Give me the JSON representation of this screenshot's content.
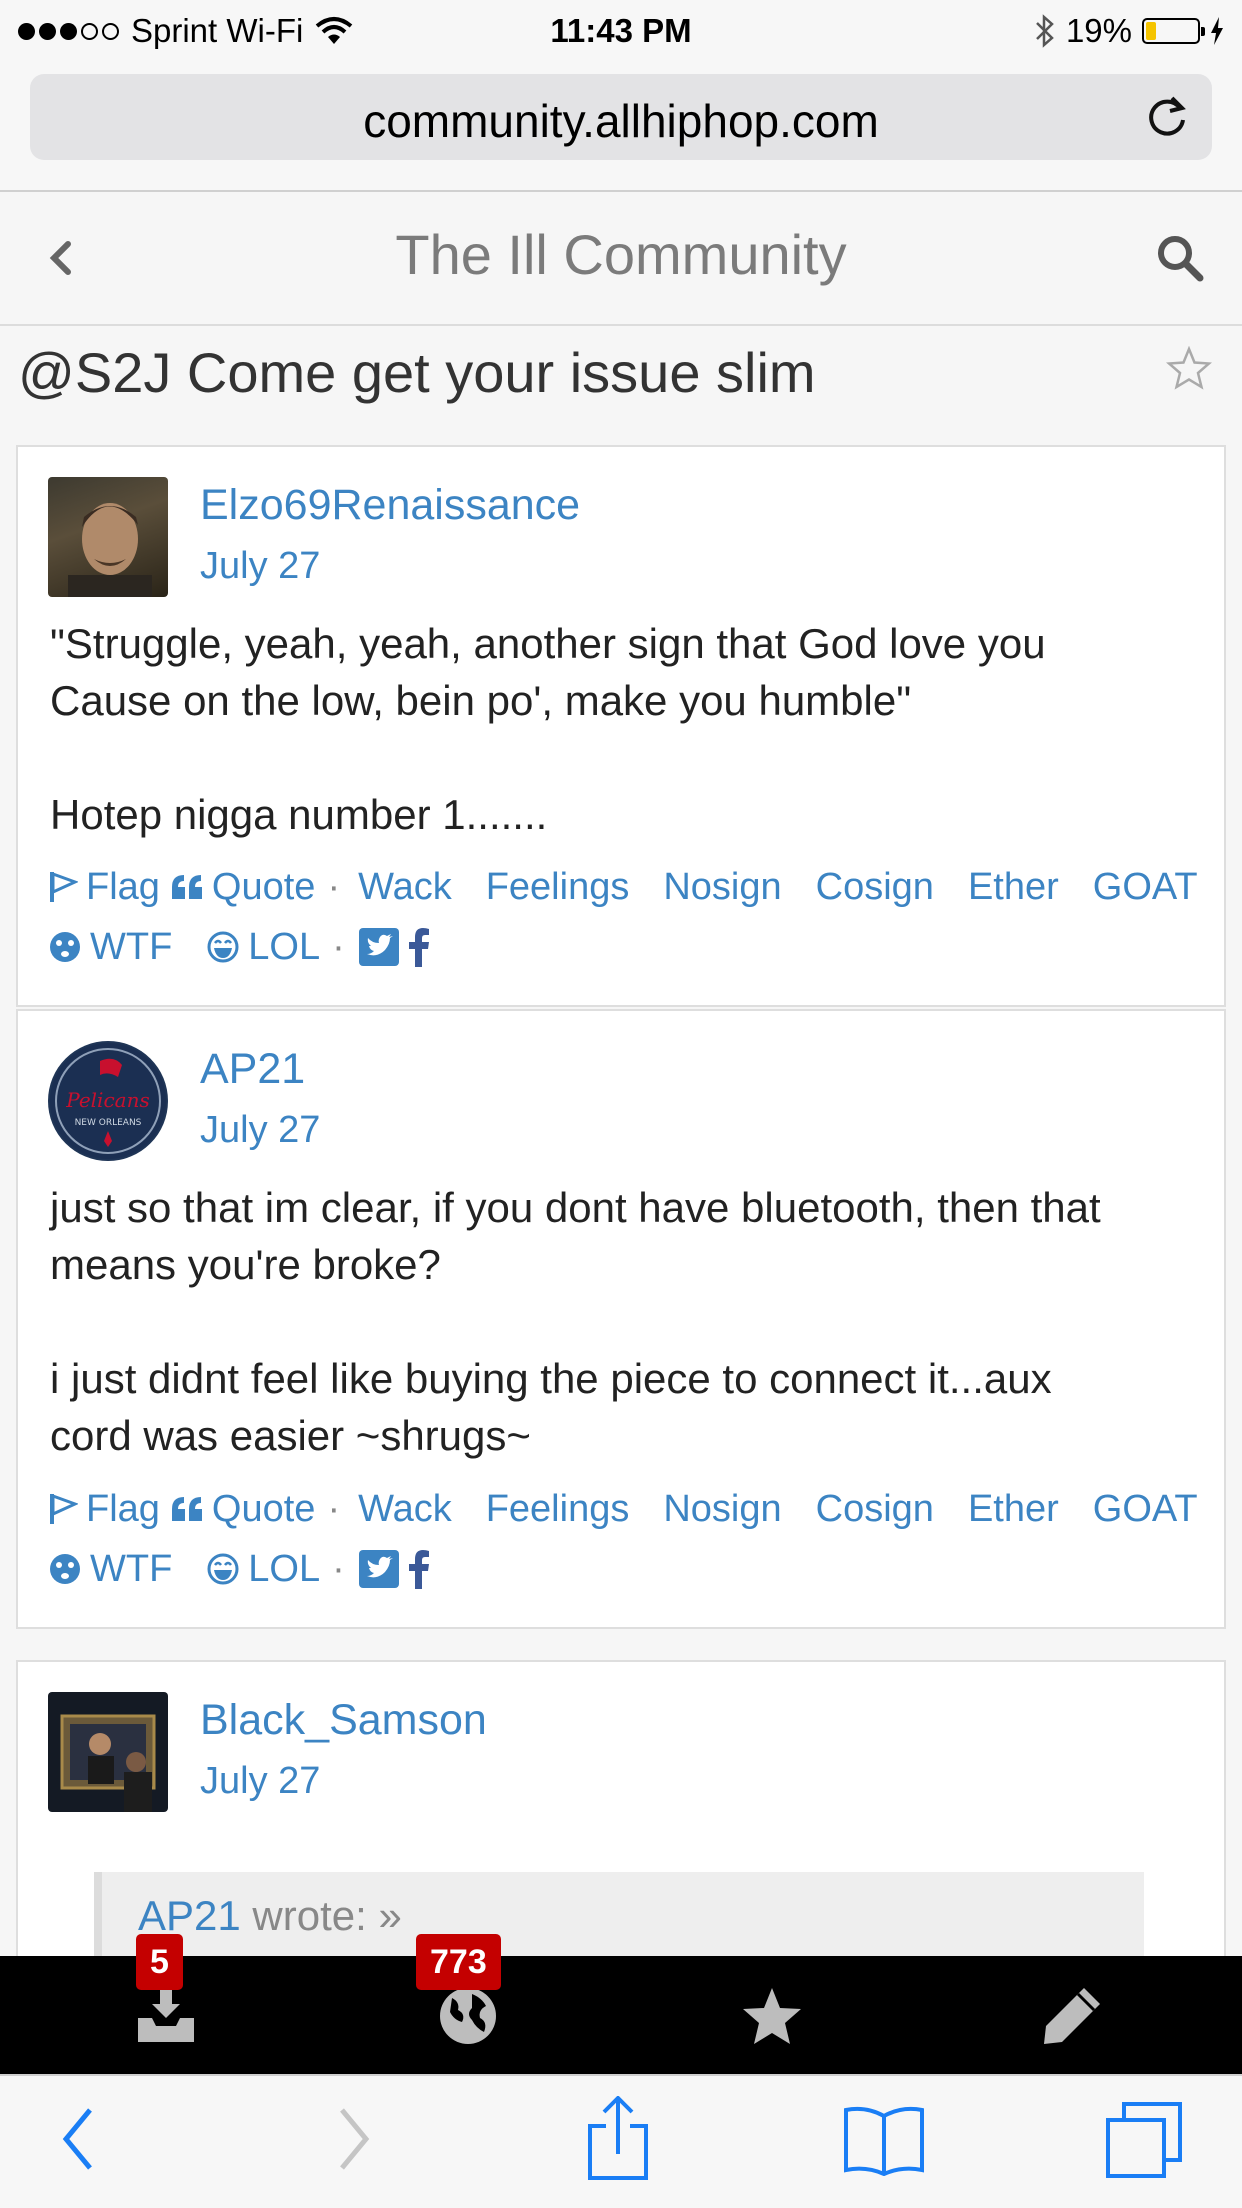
{
  "status_bar": {
    "carrier": "Sprint Wi-Fi",
    "time": "11:43 PM",
    "battery": "19%",
    "battery_level": 0.19
  },
  "browser": {
    "url": "community.allhiphop.com"
  },
  "site": {
    "title": "The Ill Community"
  },
  "thread": {
    "title": "@S2J Come get your issue slim"
  },
  "action_labels": {
    "flag": "Flag",
    "quote": "Quote",
    "reactions": [
      "Wack",
      "Feelings",
      "Nosign",
      "Cosign",
      "Ether",
      "GOAT"
    ],
    "wtf": "WTF",
    "lol": "LOL"
  },
  "posts": [
    {
      "author": "Elzo69Renaissance",
      "date": "July 27",
      "body": [
        "\"Struggle, yeah, yeah, another sign that God love you",
        "Cause on the low, bein po', make you humble\"",
        "",
        "Hotep nigga number 1......."
      ]
    },
    {
      "author": "AP21",
      "date": "July 27",
      "avatar_text": "Pelicans",
      "avatar_subtext": "NEW ORLEANS",
      "body": [
        "just so that im clear, if you dont have bluetooth, then that",
        "means you're broke?",
        "",
        "i just didnt feel like buying the piece to connect it...aux",
        "cord was easier ~shrugs~"
      ]
    },
    {
      "author": "Black_Samson",
      "date": "July 27",
      "quote_author": "AP21",
      "quote_suffix": "wrote: »"
    }
  ],
  "bottom_bar": {
    "downloads_badge": "5",
    "globe_badge": "773"
  }
}
